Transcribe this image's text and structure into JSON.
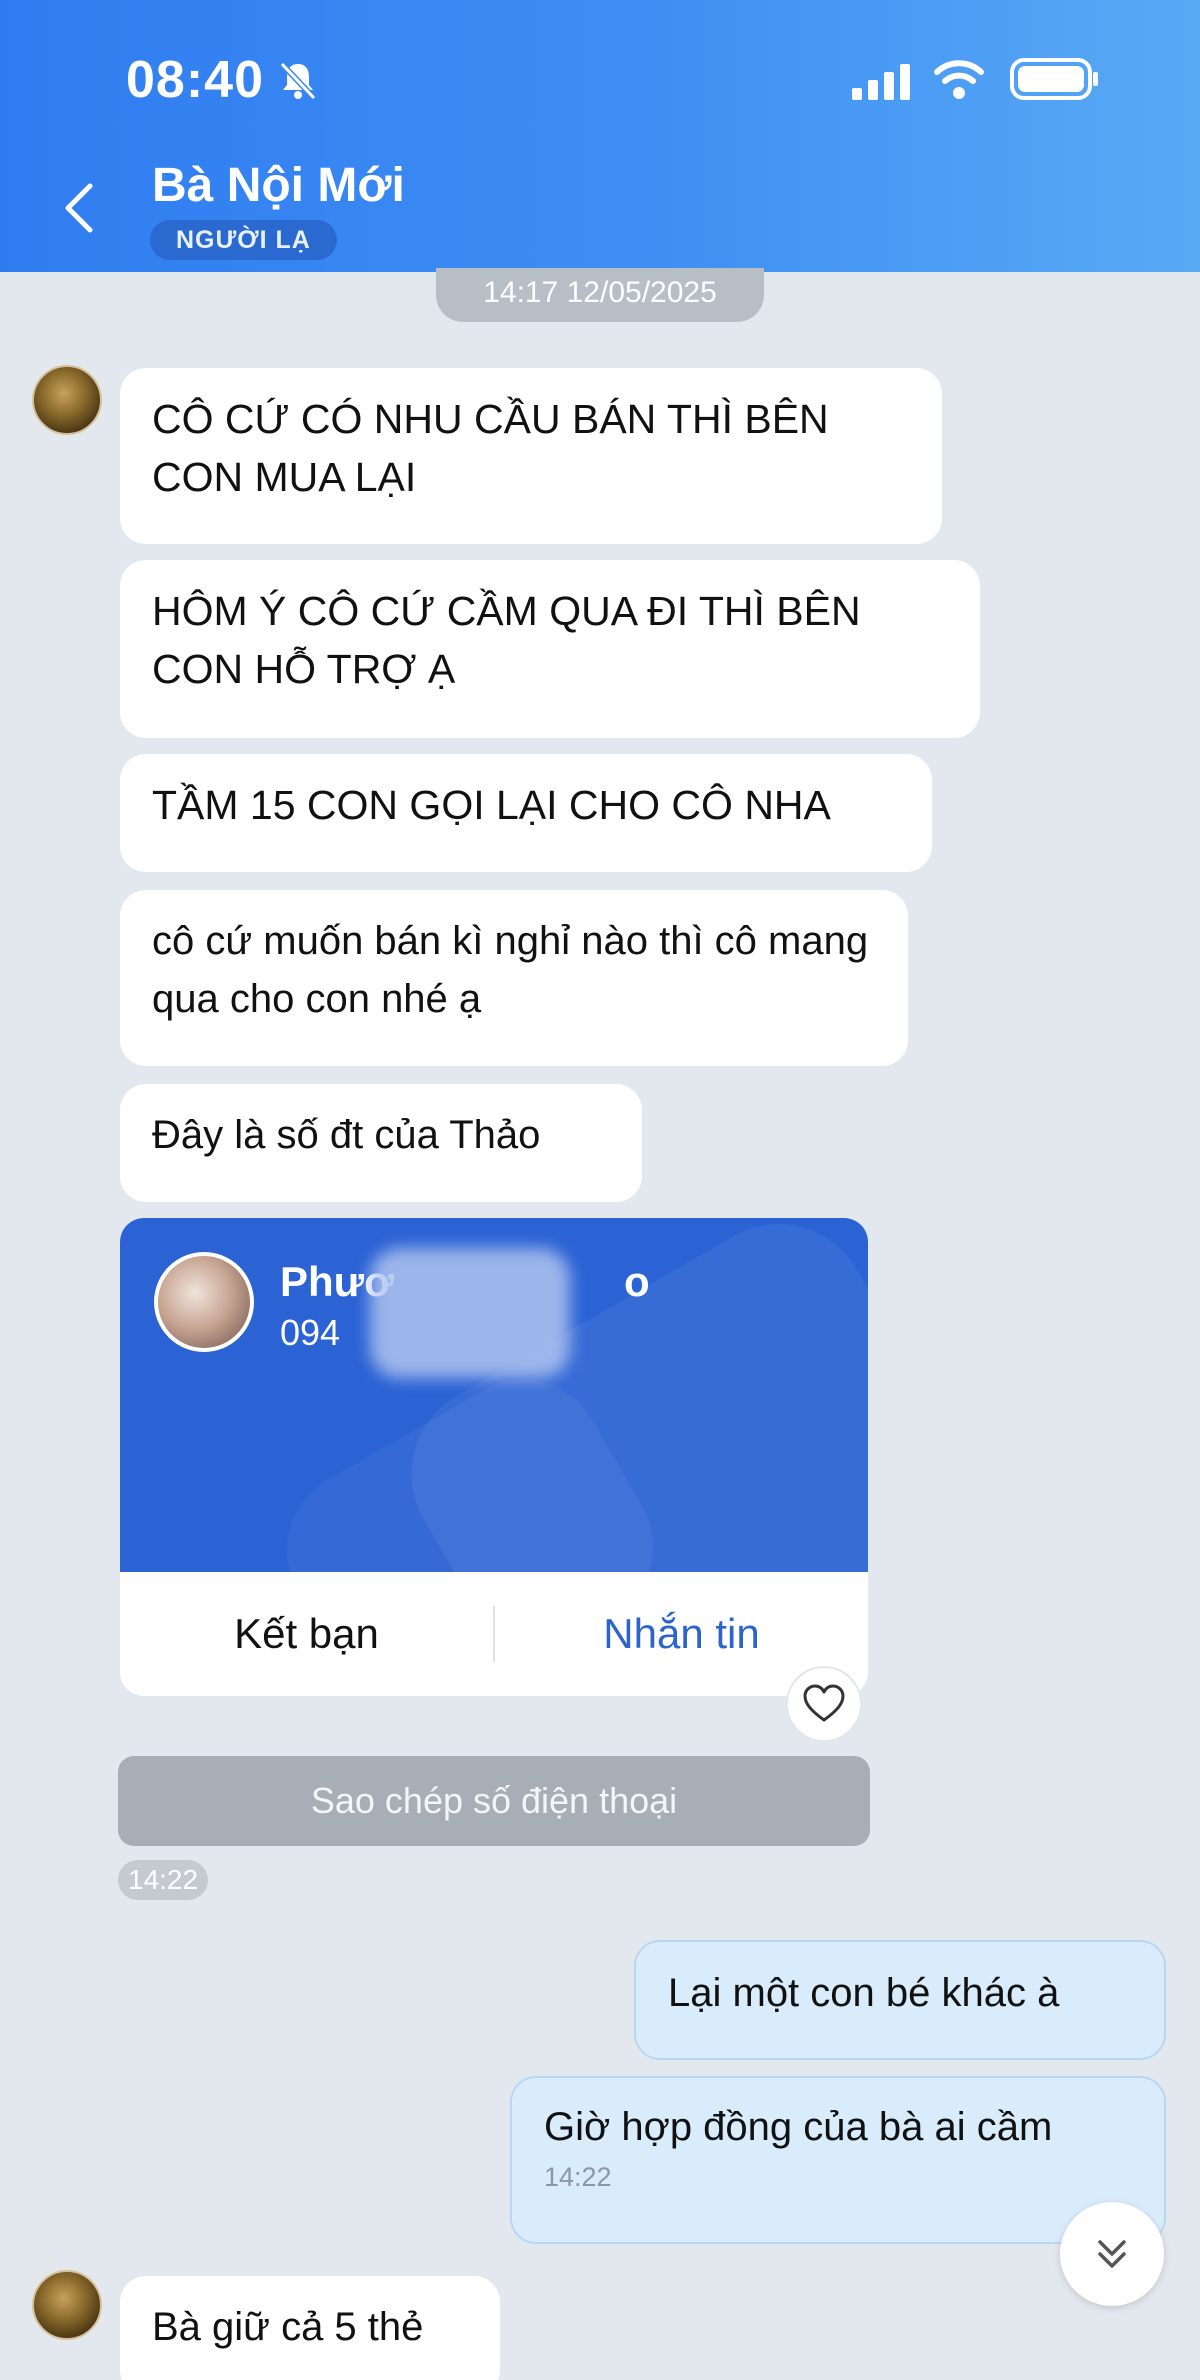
{
  "status_bar": {
    "time": "08:40"
  },
  "header": {
    "contact_name": "Bà Nội Mới",
    "stranger_label": "NGƯỜI LẠ"
  },
  "date_separator": "14:17 12/05/2025",
  "messages": [
    {
      "text": "CÔ CỨ CÓ NHU CẦU BÁN THÌ BÊN CON MUA LẠI"
    },
    {
      "text": "HÔM Ý CÔ CỨ CẦM QUA ĐI THÌ BÊN CON HỖ TRỢ Ạ"
    },
    {
      "text": "TẦM 15 CON GỌI LẠI CHO CÔ NHA"
    },
    {
      "text": "cô cứ muốn bán kì nghỉ nào thì cô mang qua cho con nhé ạ"
    },
    {
      "text": "Đây là số đt của Thảo"
    }
  ],
  "contact_card": {
    "name": "Phươ",
    "name_tail": "o",
    "phone": "094",
    "add_friend_label": "Kết bạn",
    "message_label": "Nhắn tin"
  },
  "copy_phone_label": "Sao chép số điện thoại",
  "card_time": "14:22",
  "outgoing": [
    {
      "text": "Lại một con bé khác à"
    },
    {
      "text": "Giờ hợp đồng của bà ai cầm",
      "time": "14:22"
    }
  ],
  "last_incoming": {
    "text": "Bà giữ cả 5 thẻ"
  }
}
